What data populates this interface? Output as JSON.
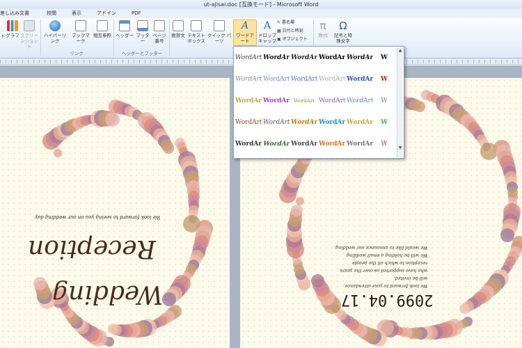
{
  "window": {
    "title": "ut-ajisai.doc [互換モード] - Microsoft Word"
  },
  "menu_tabs": [
    "差し込み文書",
    "校閲",
    "表示",
    "アドイン",
    "PDF"
  ],
  "ribbon": {
    "buttons": {
      "table_partial": "ト",
      "chart": "グラフ",
      "screenshot": "スクリーンショット",
      "hyperlink": "ハイパーリンク",
      "bookmark": "ブックマーク",
      "cross_reference": "相互参照",
      "header": "ヘッダー",
      "footer": "フッター",
      "page_number": "ページ番号",
      "greeting": "挨拶文",
      "textbox": "テキストボックス",
      "quick_parts": "クイック パーツ",
      "wordart": "ワードアート",
      "drop_cap": "ドロップキャップ",
      "signature_line": "署名欄",
      "date_time": "日付と時刻",
      "object": "オブジェクト",
      "equation": "数式",
      "symbol": "記号と特殊文字"
    },
    "groups": {
      "links": "リンク",
      "header_footer": "ヘッダーとフッター"
    }
  },
  "wordart_gallery": {
    "items": [
      "WordArt",
      "WordArt",
      "WordArt",
      "WordArt",
      "WordArt",
      "W",
      "WordArt",
      "WordArt",
      "WordArt",
      "WordArt",
      "WordArt",
      "W",
      "WordArt",
      "WordArt",
      "WordArt",
      "WordArt",
      "WordArt",
      "W",
      "WordArt",
      "WordArt",
      "WordArt",
      "WordArt",
      "WordArt",
      "W",
      "WordArt",
      "WordArt",
      "WordArt",
      "WordArt",
      "WordArt",
      "W"
    ]
  },
  "document": {
    "left_greeting": "We look forward to seeing you on our wedding day",
    "left_title_line1": "Wedding",
    "left_title_line2": "Reception",
    "right_date": "2099.04.17",
    "right_message": [
      "We would like to announce our wedding.",
      "We will be holding a small wedding",
      "reception to which all the people",
      "who have supported us over the years",
      "will be invited.",
      "We look forward to your attendance."
    ]
  }
}
